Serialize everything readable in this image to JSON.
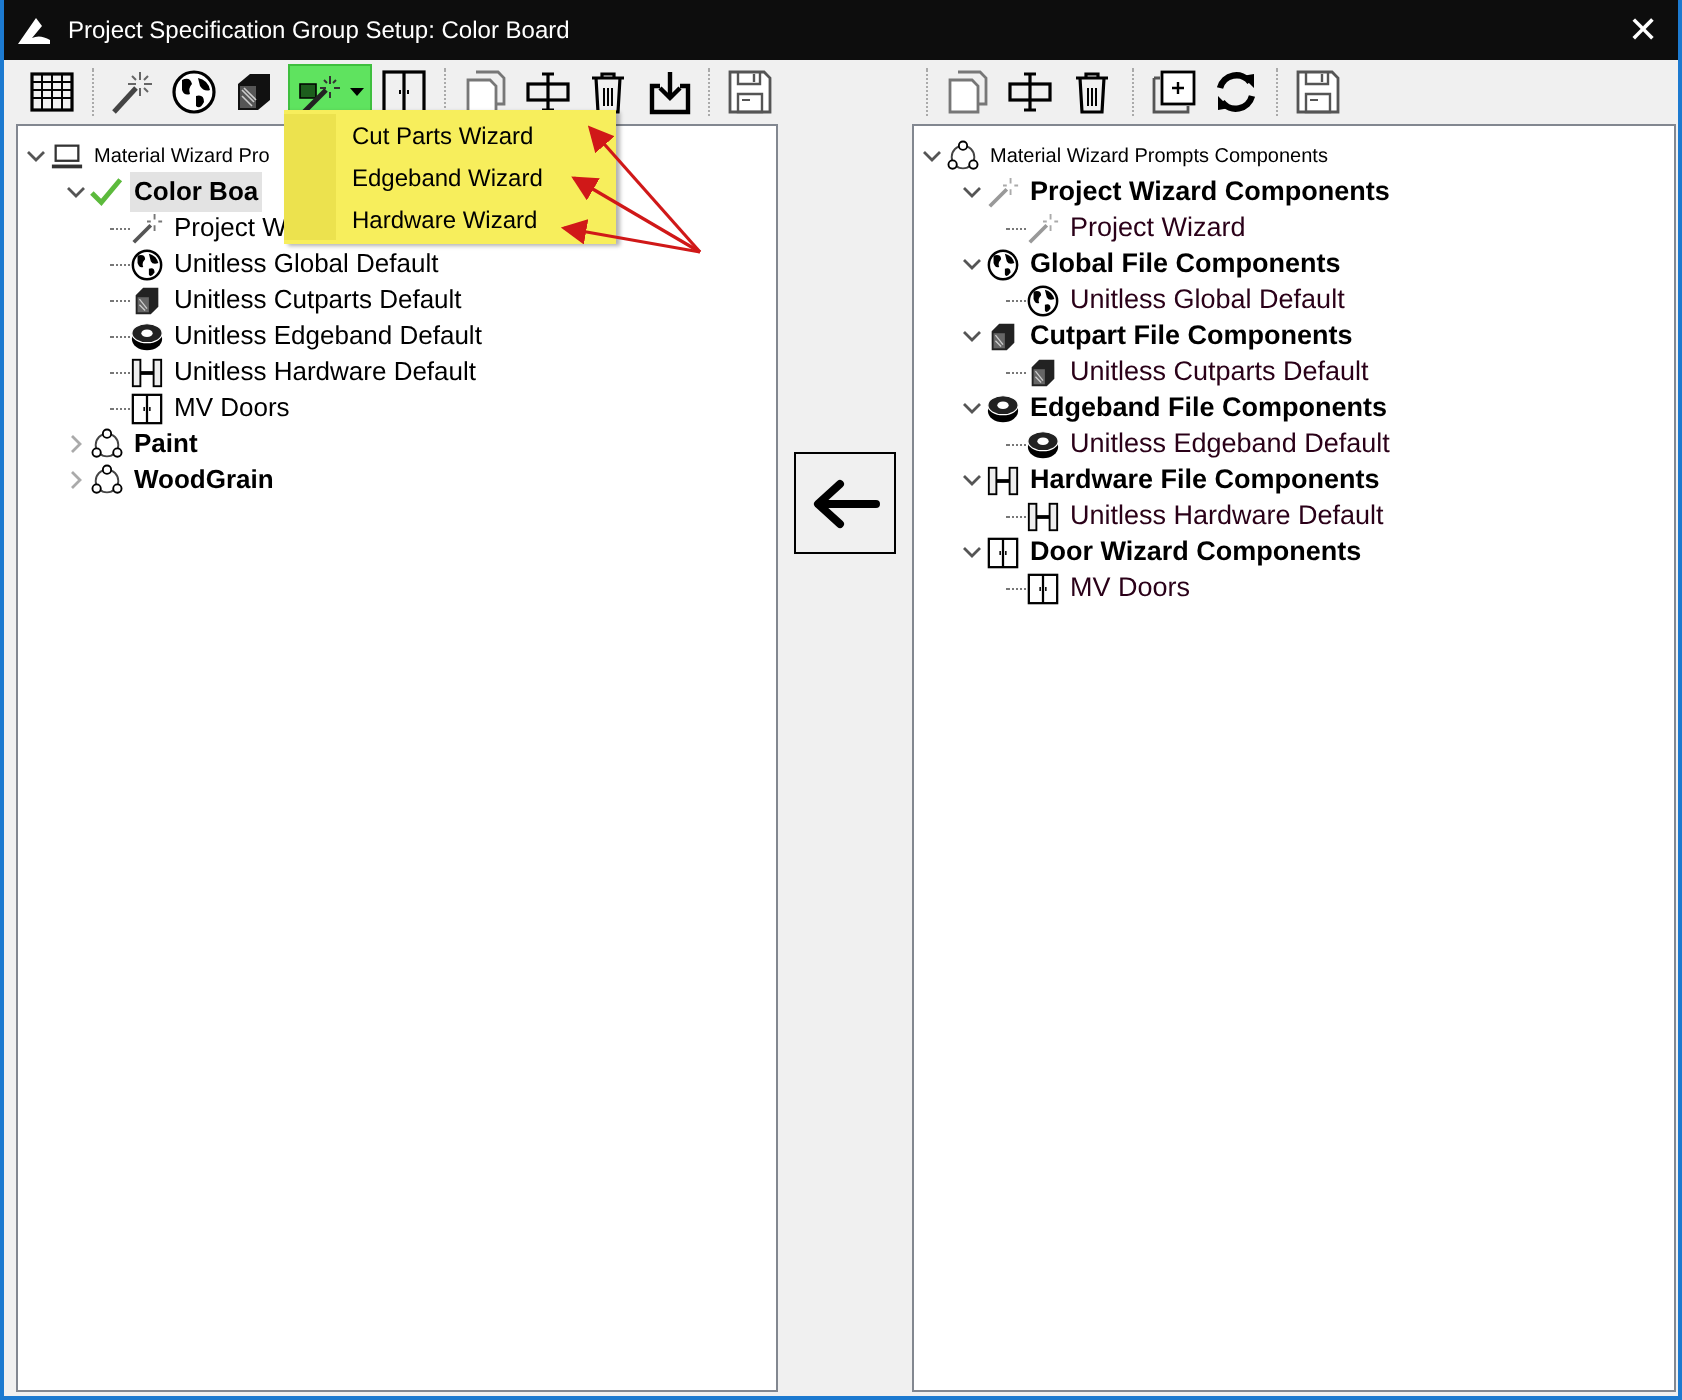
{
  "window": {
    "title": "Project Specification Group Setup: Color Board",
    "close": "✕"
  },
  "wizard_menu": {
    "expanded": true,
    "items": [
      {
        "label": "Cut Parts Wizard"
      },
      {
        "label": "Edgeband Wizard"
      },
      {
        "label": "Hardware Wizard"
      }
    ]
  },
  "left_tree": [
    {
      "label": "Material Wizard Pro",
      "kind": "computer",
      "expanded": true,
      "selected": false,
      "children": [
        {
          "label": "Color Boa",
          "kind": "check",
          "expanded": true,
          "selected": true,
          "children": [
            {
              "label": "Project W",
              "kind": "wand",
              "selected": false
            },
            {
              "label": "Unitless Global Default",
              "kind": "globe",
              "selected": false
            },
            {
              "label": "Unitless Cutparts Default",
              "kind": "cube",
              "selected": false
            },
            {
              "label": "Unitless Edgeband Default",
              "kind": "edgeband",
              "selected": false
            },
            {
              "label": "Unitless Hardware Default",
              "kind": "hardware",
              "selected": false
            },
            {
              "label": "MV Doors",
              "kind": "door",
              "selected": false
            }
          ]
        },
        {
          "label": "Paint",
          "kind": "group",
          "expanded": false,
          "selected": false
        },
        {
          "label": "WoodGrain",
          "kind": "group",
          "expanded": false,
          "selected": false
        }
      ]
    }
  ],
  "right_tree": [
    {
      "label": "Material Wizard Prompts Components",
      "kind": "group",
      "expanded": true,
      "children": [
        {
          "label": "Project Wizard Components",
          "kind": "wandgray",
          "expanded": true,
          "children": [
            {
              "label": "Project Wizard",
              "kind": "wandgray"
            }
          ]
        },
        {
          "label": "Global File Components",
          "kind": "globe",
          "expanded": true,
          "children": [
            {
              "label": "Unitless Global Default",
              "kind": "globe"
            }
          ]
        },
        {
          "label": "Cutpart File Components",
          "kind": "cube",
          "expanded": true,
          "children": [
            {
              "label": "Unitless Cutparts Default",
              "kind": "cube"
            }
          ]
        },
        {
          "label": "Edgeband File Components",
          "kind": "edgeband",
          "expanded": true,
          "children": [
            {
              "label": "Unitless Edgeband Default",
              "kind": "edgeband"
            }
          ]
        },
        {
          "label": "Hardware File Components",
          "kind": "hardware",
          "expanded": true,
          "children": [
            {
              "label": "Unitless Hardware Default",
              "kind": "hardware"
            }
          ]
        },
        {
          "label": "Door Wizard Components",
          "kind": "door",
          "expanded": true,
          "children": [
            {
              "label": "MV Doors",
              "kind": "door"
            }
          ]
        }
      ]
    }
  ]
}
